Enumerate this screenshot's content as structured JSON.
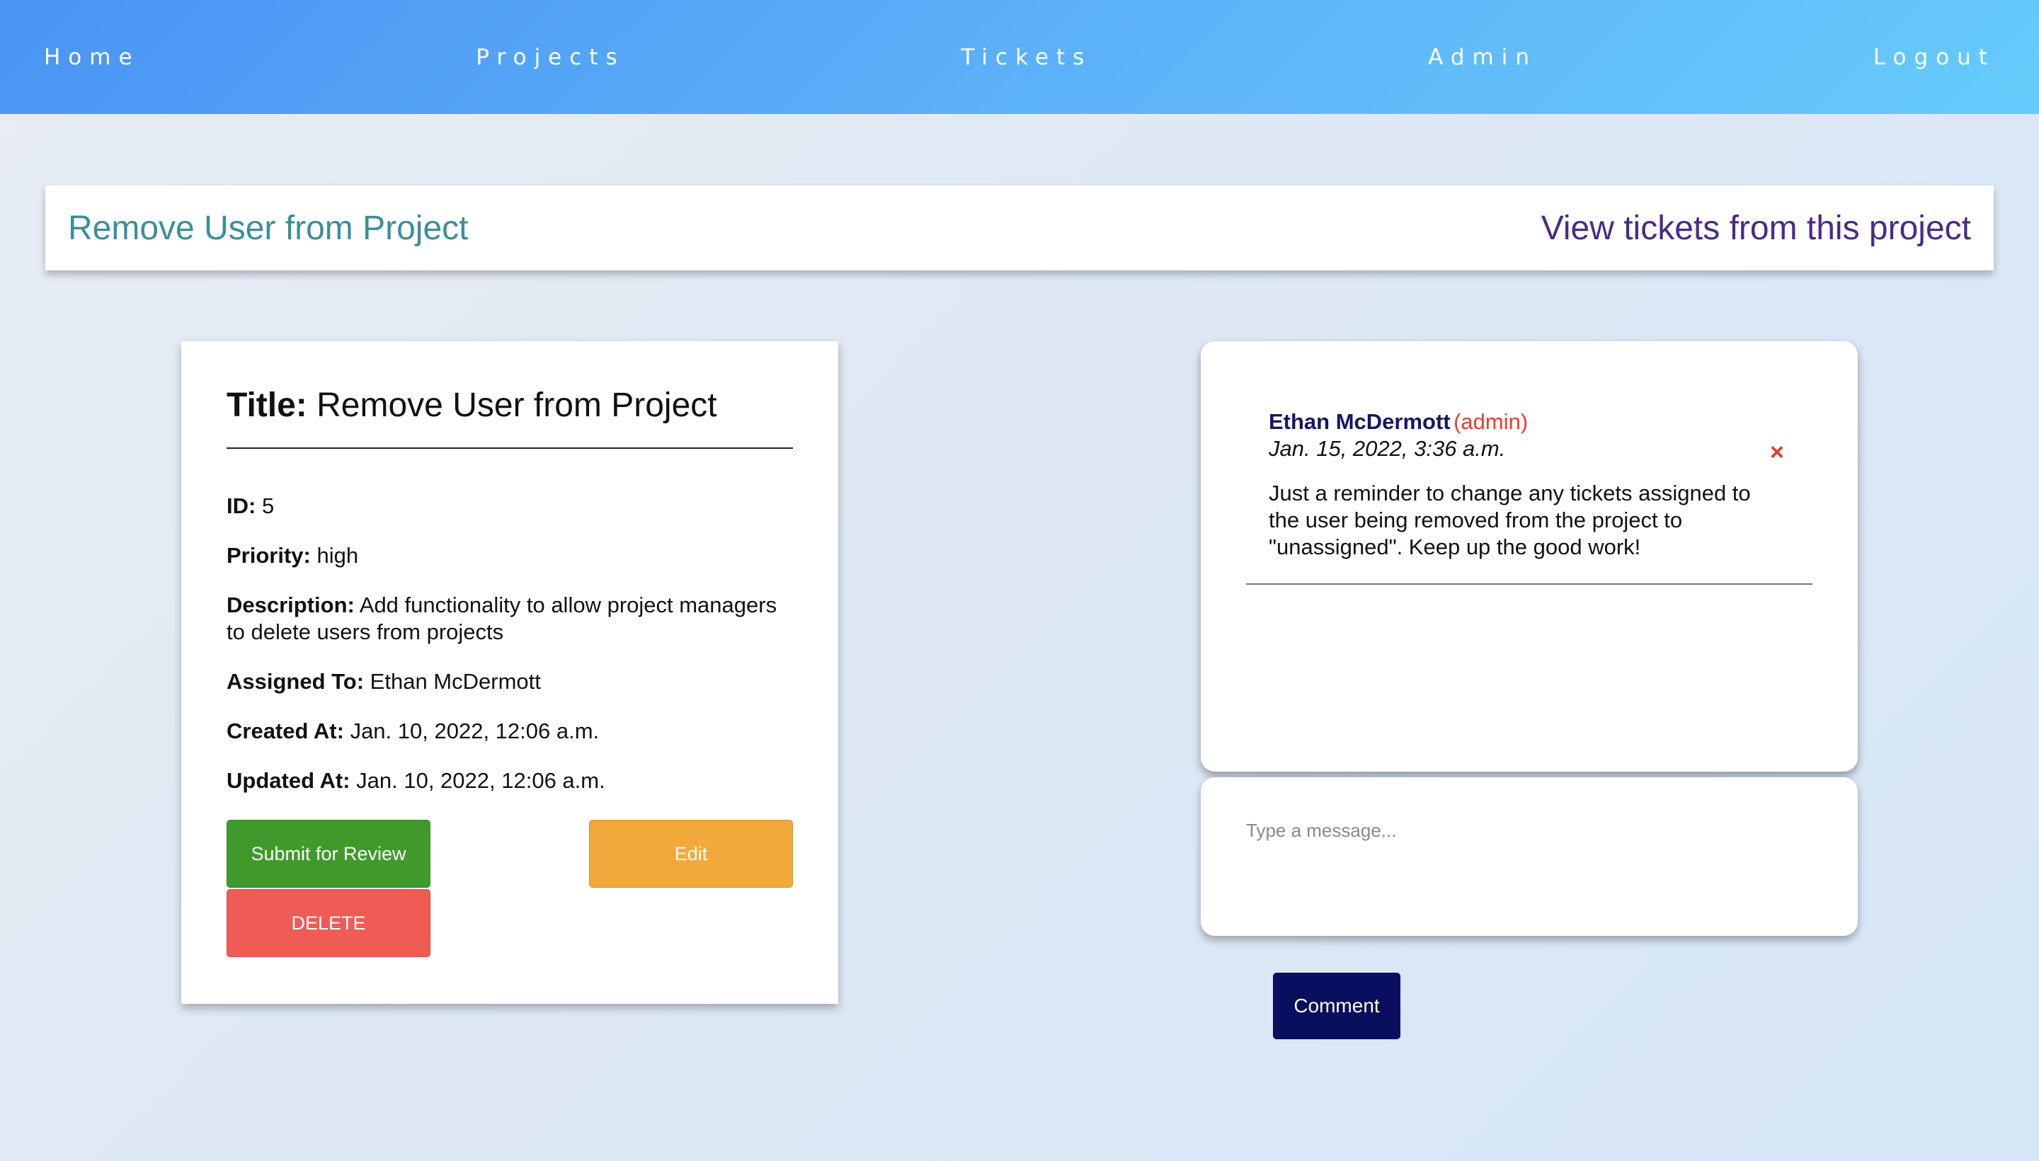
{
  "nav": {
    "items": [
      "Home",
      "Projects",
      "Tickets",
      "Admin",
      "Logout"
    ]
  },
  "header": {
    "title": "Remove User from Project",
    "link": "View tickets from this project"
  },
  "ticket": {
    "title_label": "Title:",
    "title_value": "Remove User from Project",
    "fields": [
      {
        "label": "ID:",
        "value": "5"
      },
      {
        "label": "Priority:",
        "value": "high"
      },
      {
        "label": "Description:",
        "value": "Add functionality to allow project managers to delete users from projects"
      },
      {
        "label": "Assigned To:",
        "value": "Ethan McDermott"
      },
      {
        "label": "Created At:",
        "value": "Jan. 10, 2022, 12:06 a.m."
      },
      {
        "label": "Updated At:",
        "value": "Jan. 10, 2022, 12:06 a.m."
      }
    ],
    "buttons": {
      "submit": "Submit for Review",
      "edit": "Edit",
      "delete": "DELETE"
    }
  },
  "comments": [
    {
      "author": "Ethan McDermott",
      "role": "(admin)",
      "date": "Jan. 15, 2022, 3:36 a.m.",
      "text": "Just a reminder to change any tickets assigned to the user being removed from the project to \"unassigned\". Keep up the good work!",
      "delete_glyph": "×"
    }
  ],
  "message": {
    "placeholder": "Type a message..."
  },
  "comment_button": "Comment",
  "colors": {
    "submit": "#3f9a2b",
    "edit": "#f2a93b",
    "delete": "#ef5b55",
    "comment_button": "#0a0e5e",
    "author": "#141863",
    "role": "#e8402e"
  }
}
